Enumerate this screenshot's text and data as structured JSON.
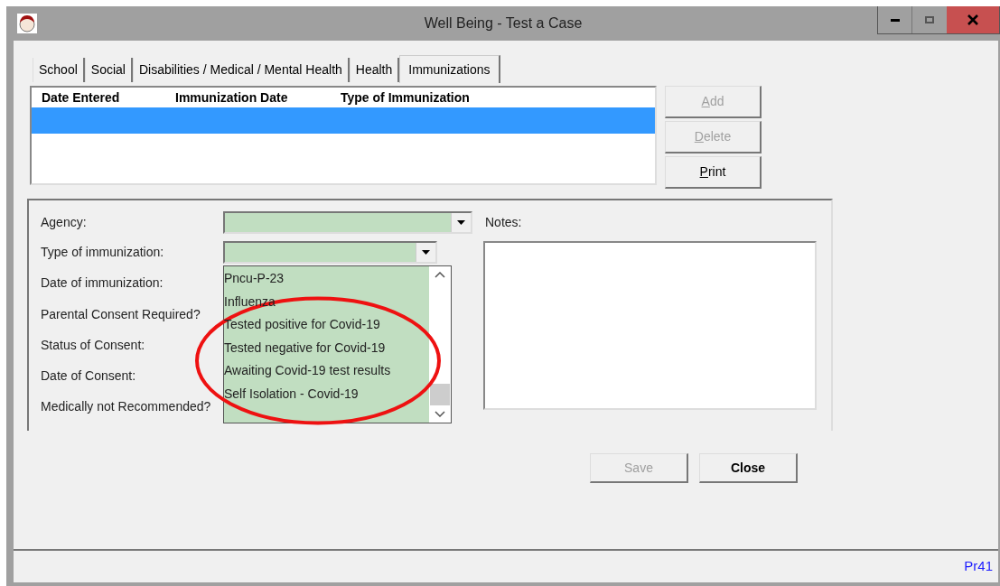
{
  "window": {
    "title": "Well Being - Test a Case"
  },
  "tabs": [
    {
      "label": "School",
      "selected": false
    },
    {
      "label": "Social",
      "selected": false
    },
    {
      "label": "Disabilities / Medical / Mental Health",
      "selected": false
    },
    {
      "label": "Health",
      "selected": false
    },
    {
      "label": "Immunizations",
      "selected": true
    }
  ],
  "list": {
    "columns": [
      "Date Entered",
      "Immunization Date",
      "Type of Immunization"
    ],
    "rows": [
      {
        "selected": true
      }
    ]
  },
  "list_buttons": [
    {
      "label": "Add",
      "disabled": true,
      "underline_first": true
    },
    {
      "label": "Delete",
      "disabled": true,
      "underline_first": true
    },
    {
      "label": "Print",
      "disabled": false,
      "underline_first": true
    }
  ],
  "form": {
    "fields": [
      {
        "label": "Agency:",
        "kind": "combo"
      },
      {
        "label": "Type of immunization:",
        "kind": "combo",
        "open": true
      },
      {
        "label": "Date of immunization:",
        "kind": "label"
      },
      {
        "label": "Parental Consent Required?",
        "kind": "label"
      },
      {
        "label": "Status of Consent:",
        "kind": "label"
      },
      {
        "label": "Date of Consent:",
        "kind": "label"
      },
      {
        "label": "Medically not Recommended?",
        "kind": "label"
      }
    ],
    "dropdown_options": [
      "Pncu-P-23",
      "Influenza",
      "Tested positive for Covid-19",
      "Tested negative for Covid-19",
      "Awaiting Covid-19 test results",
      "Self Isolation - Covid-19"
    ],
    "notes": {
      "label": "Notes:"
    }
  },
  "buttons": [
    {
      "label": "Save",
      "disabled": true
    },
    {
      "label": "Close",
      "disabled": false
    }
  ],
  "status_bar": {
    "code": "Pr41"
  },
  "annotation": {
    "kind": "ellipse"
  }
}
